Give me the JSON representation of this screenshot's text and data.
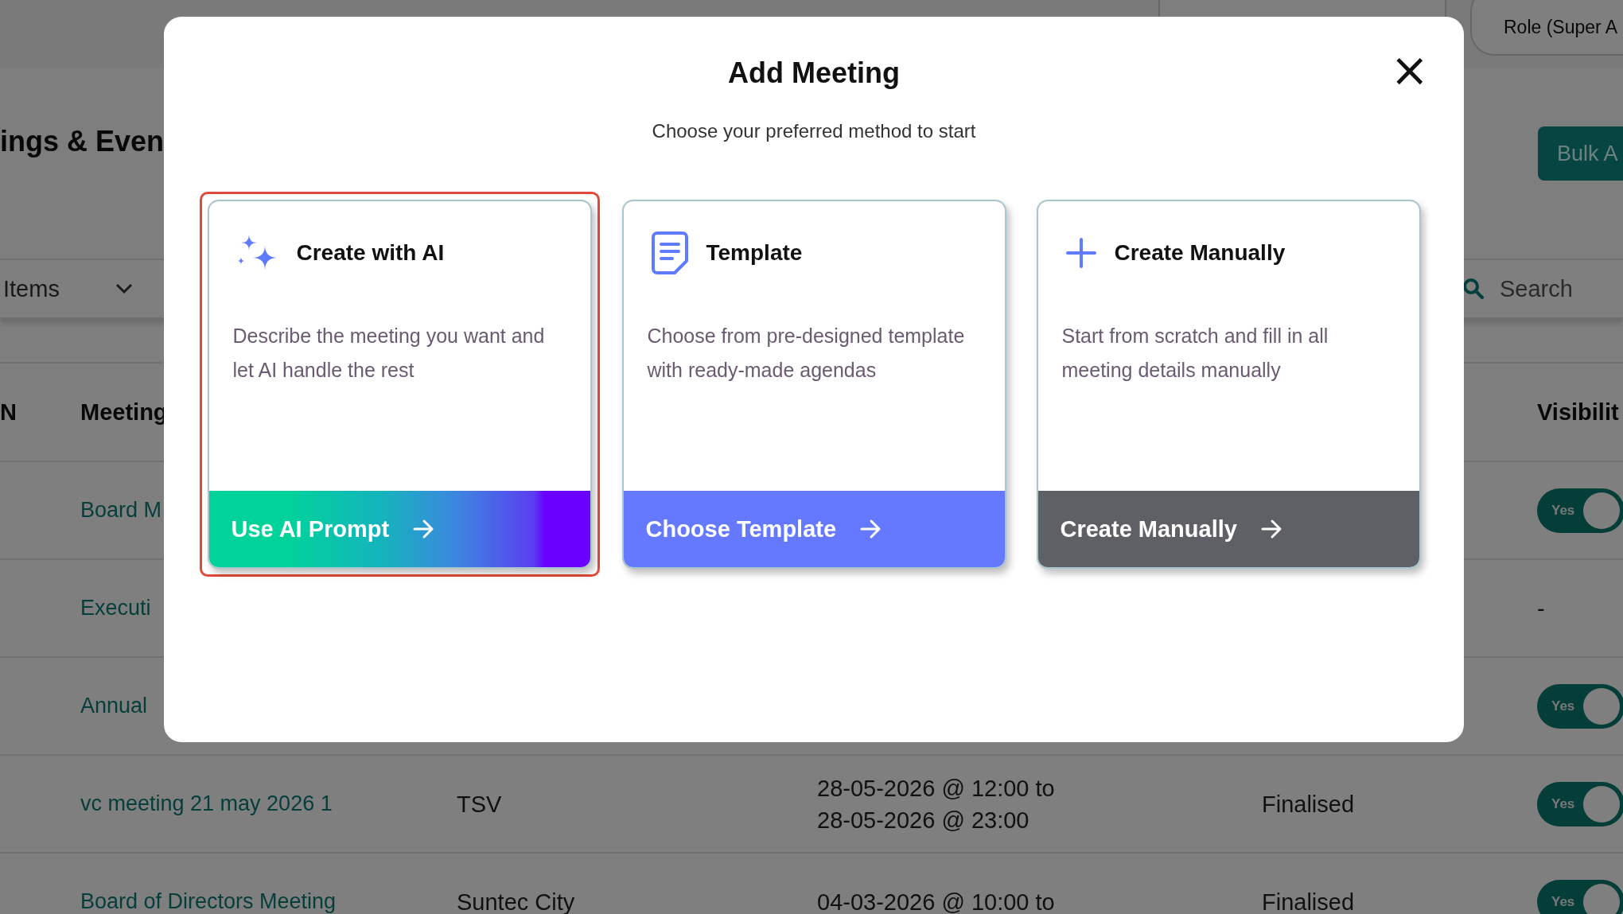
{
  "top_bar": {
    "role_button": "Role (Super A"
  },
  "page": {
    "heading": "ings & Even",
    "bulk_button": "Bulk A",
    "filter": {
      "value": "Items"
    },
    "search": {
      "placeholder": "Search"
    }
  },
  "table": {
    "columns": [
      "N",
      "Meeting",
      "Visibilit"
    ],
    "rows": [
      {
        "meeting": "Board M",
        "visibility": {
          "kind": "toggle",
          "on": true,
          "label": "Yes"
        }
      },
      {
        "meeting": "Executi",
        "visibility": {
          "kind": "text",
          "text": "-"
        }
      },
      {
        "meeting": "Annual",
        "visibility": {
          "kind": "toggle",
          "on": true,
          "label": "Yes"
        }
      },
      {
        "meeting": "vc meeting 21 may 2026 1",
        "location": "TSV",
        "date_lines": [
          "28-05-2026 @ 12:00 to",
          "28-05-2026 @ 23:00"
        ],
        "status": "Finalised",
        "visibility": {
          "kind": "toggle",
          "on": true,
          "label": "Yes"
        }
      },
      {
        "meeting": "Board of Directors Meeting",
        "location": "Suntec City",
        "date_lines": [
          "04-03-2026 @ 10:00 to"
        ],
        "status": "Finalised",
        "visibility": {
          "kind": "toggle",
          "on": true,
          "label": "Yes"
        }
      }
    ]
  },
  "modal": {
    "title": "Add Meeting",
    "close": "×",
    "subtitle": "Choose your preferred method to start",
    "options": [
      {
        "kind": "ai",
        "title": "Create with AI",
        "description": "Describe the meeting you want and let AI handle the rest",
        "action": "Use AI Prompt",
        "selected": true
      },
      {
        "kind": "template",
        "title": "Template",
        "description": "Choose from pre-designed template with ready-made agendas",
        "action": "Choose Template",
        "selected": false
      },
      {
        "kind": "manual",
        "title": "Create Manually",
        "description": "Start from scratch and fill in all meeting details manually",
        "action": "Create Manually",
        "selected": false
      }
    ]
  }
}
